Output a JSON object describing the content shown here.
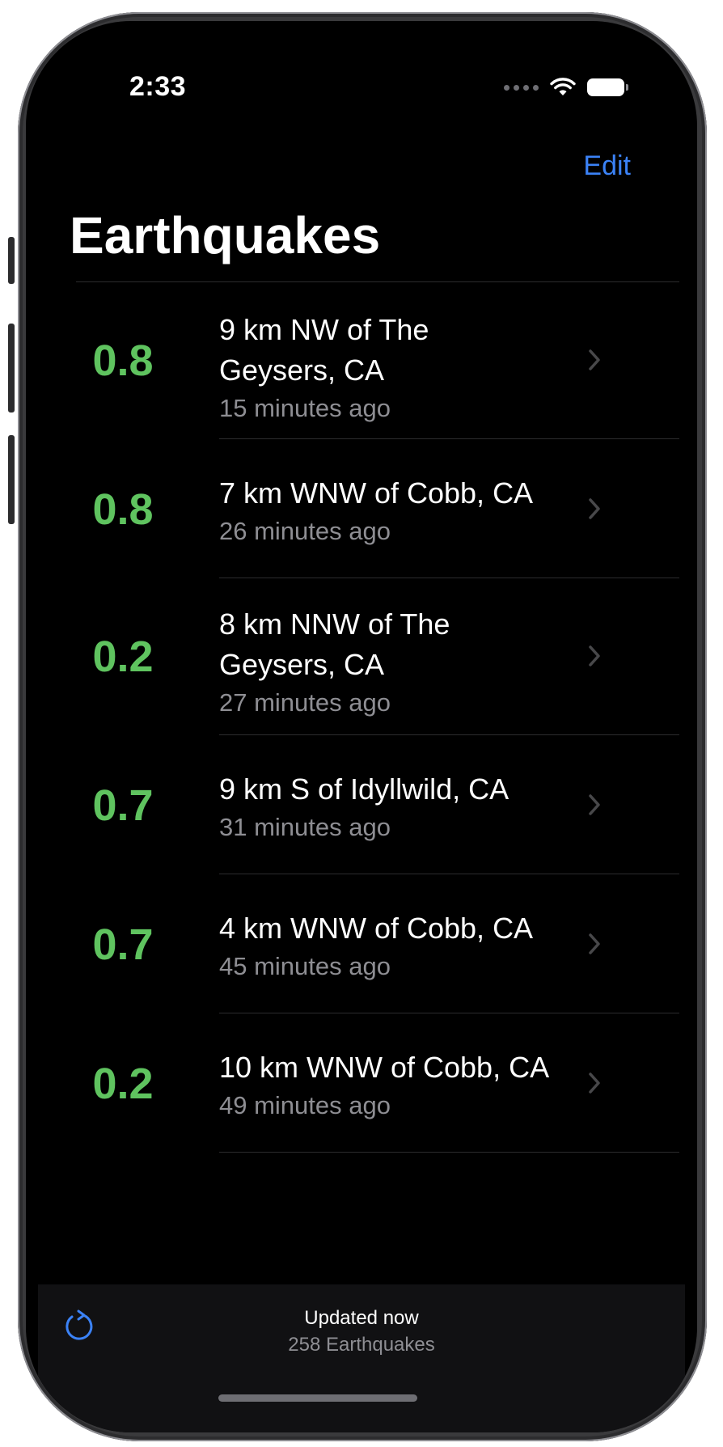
{
  "status_bar": {
    "time": "2:33",
    "icons": [
      "cellular-dots-icon",
      "wifi-icon",
      "battery-icon"
    ]
  },
  "nav": {
    "edit_label": "Edit",
    "title": "Earthquakes"
  },
  "quakes": [
    {
      "magnitude": "0.8",
      "place_line1": "9 km NW of The",
      "place_line2": "Geysers, CA",
      "time_ago": "15 minutes ago"
    },
    {
      "magnitude": "0.8",
      "place_line1": "7 km WNW of Cobb, CA",
      "place_line2": "",
      "time_ago": "26 minutes ago"
    },
    {
      "magnitude": "0.2",
      "place_line1": "8 km NNW of The",
      "place_line2": "Geysers, CA",
      "time_ago": "27 minutes ago"
    },
    {
      "magnitude": "0.7",
      "place_line1": "9 km S of Idyllwild, CA",
      "place_line2": "",
      "time_ago": "31 minutes ago"
    },
    {
      "magnitude": "0.7",
      "place_line1": "4 km WNW of Cobb, CA",
      "place_line2": "",
      "time_ago": "45 minutes ago"
    },
    {
      "magnitude": "0.2",
      "place_line1": "10 km WNW of Cobb, CA",
      "place_line2": "",
      "time_ago": "49 minutes ago"
    }
  ],
  "toolbar": {
    "refresh_icon": "refresh-icon",
    "updated_label": "Updated now",
    "count_label": "258 Earthquakes"
  },
  "colors": {
    "accent": "#3b82f6",
    "magnitude": "#5fc35f",
    "background": "#000000",
    "secondary_text": "#8e8e93"
  }
}
